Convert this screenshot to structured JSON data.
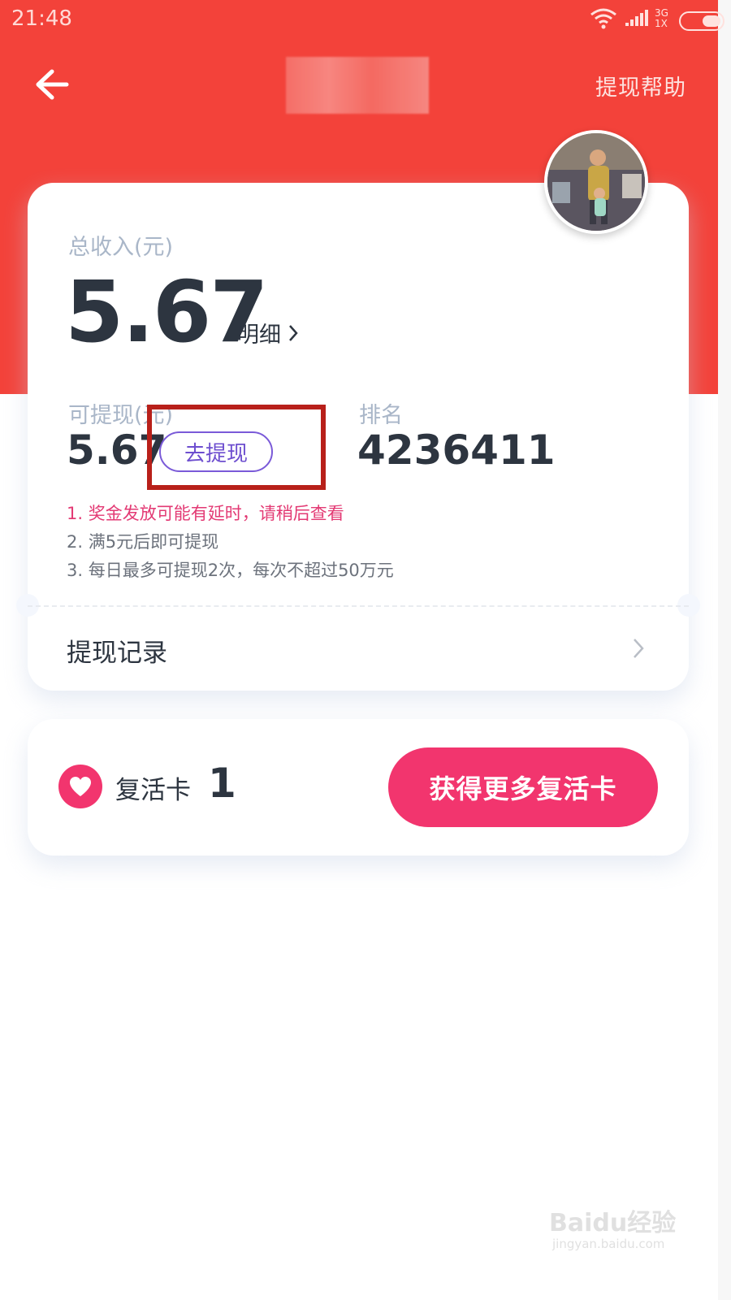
{
  "status_bar": {
    "time": "21:48",
    "network": "3G",
    "sim_label": "1X"
  },
  "nav": {
    "help_label": "提现帮助"
  },
  "summary": {
    "total_label": "总收入(元)",
    "total_amount": "5.67",
    "detail_label": "明细",
    "withdrawable_label": "可提现(元)",
    "withdrawable_amount": "5.67",
    "withdraw_button": "去提现",
    "rank_label": "排名",
    "rank_value": "4236411"
  },
  "notes": [
    "1. 奖金发放可能有延时，请稍后查看",
    "2. 满5元后即可提现",
    "3. 每日最多可提现2次，每次不超过50万元"
  ],
  "records": {
    "label": "提现记录"
  },
  "revive": {
    "label": "复活卡",
    "count": "1",
    "button_label": "获得更多复活卡"
  },
  "watermark": {
    "main": "Baidu经验",
    "sub": "jingyan.baidu.com"
  },
  "colors": {
    "header_red": "#f3423a",
    "accent_pink": "#f2356e",
    "withdraw_purple": "#6d4ecf",
    "highlight_box": "#b8201a"
  }
}
